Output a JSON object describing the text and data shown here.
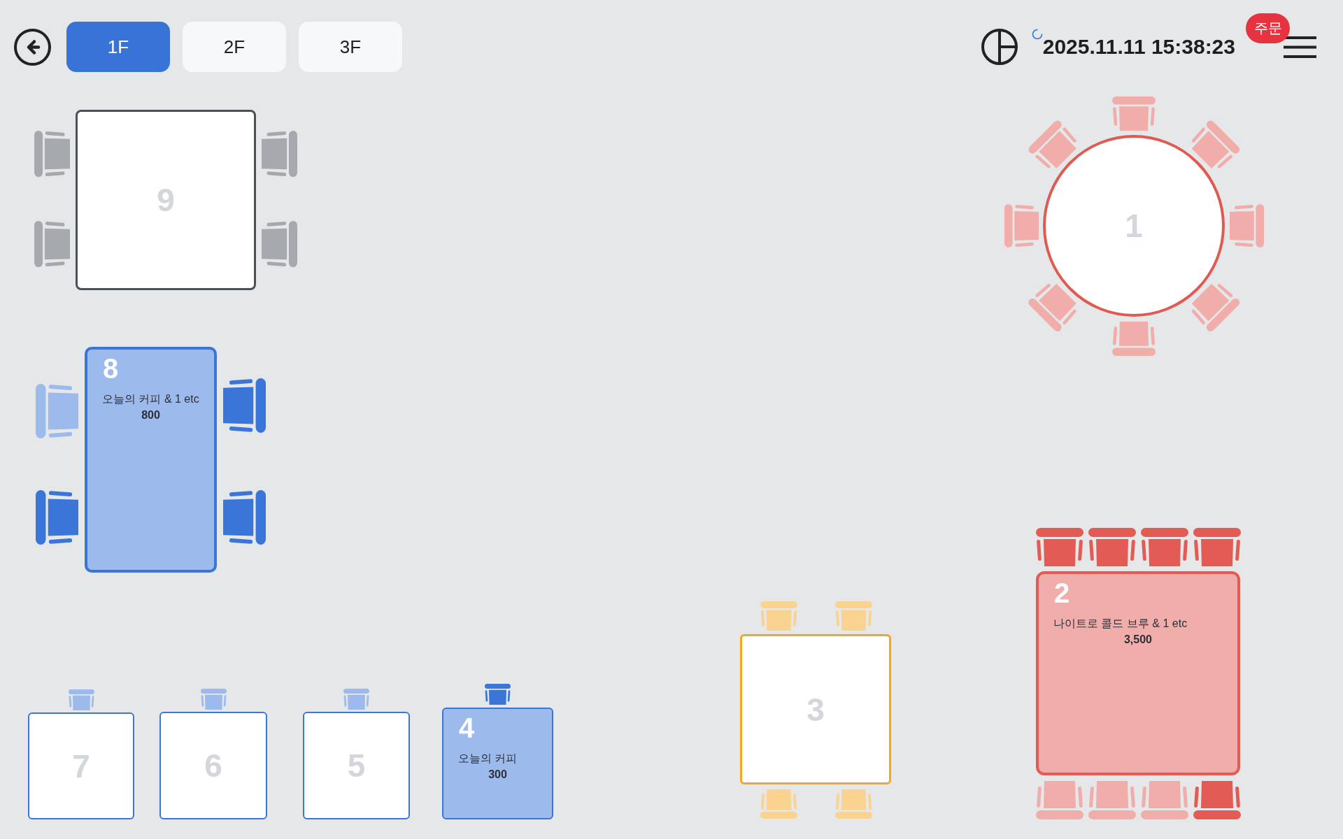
{
  "floors": [
    {
      "label": "1F",
      "selected": true
    },
    {
      "label": "2F",
      "selected": false
    },
    {
      "label": "3F",
      "selected": false
    }
  ],
  "header": {
    "syncing": true,
    "datetime": "2025.11.11 15:38:23",
    "order_badge": "주문"
  },
  "tables": [
    {
      "number": "9",
      "kind": "rect",
      "color": "#4a5058",
      "chairs": [
        {
          "occupied": false
        },
        {
          "occupied": false
        },
        {
          "occupied": false
        },
        {
          "occupied": false
        }
      ]
    },
    {
      "number": "1",
      "kind": "round",
      "color": "#e05a52",
      "chairs": [
        {
          "occupied": false
        },
        {
          "occupied": false
        },
        {
          "occupied": false
        },
        {
          "occupied": false
        },
        {
          "occupied": false
        },
        {
          "occupied": false
        },
        {
          "occupied": false
        },
        {
          "occupied": false
        }
      ]
    },
    {
      "number": "8",
      "kind": "rect",
      "color": "#3a75d8",
      "order": {
        "items": "오늘의 커피 & 1 etc",
        "amount": "800"
      },
      "chairs": [
        {
          "occupied": false
        },
        {
          "occupied": true
        },
        {
          "occupied": true
        },
        {
          "occupied": true
        }
      ]
    },
    {
      "number": "2",
      "kind": "rect",
      "color": "#e25b54",
      "order": {
        "items": "나이트로 콜드 브루 & 1 etc",
        "amount": "3,500"
      },
      "chairs": [
        {
          "occupied": true
        },
        {
          "occupied": true
        },
        {
          "occupied": true
        },
        {
          "occupied": true
        },
        {
          "occupied": false
        },
        {
          "occupied": false
        },
        {
          "occupied": false
        },
        {
          "occupied": true
        }
      ]
    },
    {
      "number": "3",
      "kind": "rect",
      "color": "#f5a623",
      "chairs": [
        {
          "occupied": false
        },
        {
          "occupied": false
        },
        {
          "occupied": false
        },
        {
          "occupied": false
        }
      ]
    },
    {
      "number": "7",
      "kind": "rect",
      "color": "#3a75d8",
      "chairs": [
        {
          "occupied": false
        }
      ]
    },
    {
      "number": "6",
      "kind": "rect",
      "color": "#3a75d8",
      "chairs": [
        {
          "occupied": false
        }
      ]
    },
    {
      "number": "5",
      "kind": "rect",
      "color": "#3a75d8",
      "chairs": [
        {
          "occupied": false
        }
      ]
    },
    {
      "number": "4",
      "kind": "rect",
      "color": "#3a75d8",
      "order": {
        "items": "오늘의 커피",
        "amount": "300"
      },
      "chairs": [
        {
          "occupied": true
        }
      ]
    }
  ]
}
